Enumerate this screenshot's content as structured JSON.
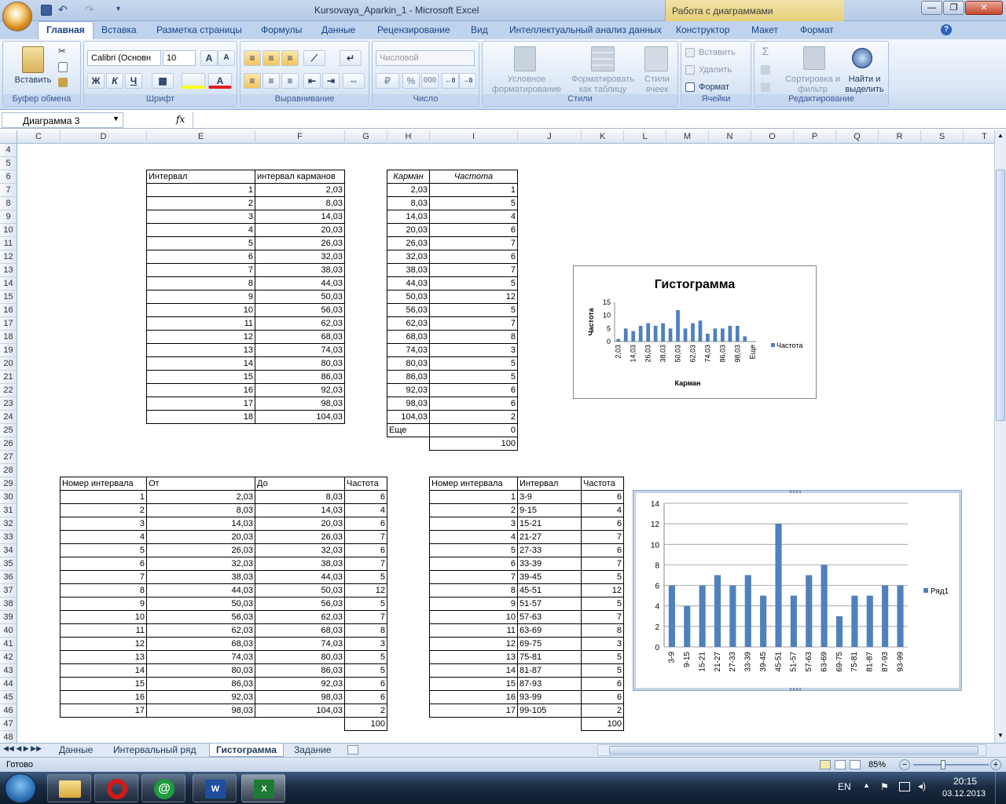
{
  "window": {
    "title": "Kursovaya_Aparkin_1 - Microsoft Excel",
    "context_title": "Работа с диаграммами",
    "minimize": "—",
    "restore": "❐",
    "close": "✕"
  },
  "tabs": [
    "Главная",
    "Вставка",
    "Разметка страницы",
    "Формулы",
    "Данные",
    "Рецензирование",
    "Вид",
    "Интеллектуальный анализ данных",
    "Конструктор",
    "Макет",
    "Формат"
  ],
  "ribbon": {
    "clipboard": {
      "label": "Буфер обмена",
      "paste": "Вставить"
    },
    "font": {
      "label": "Шрифт",
      "family": "Calibri (Основн",
      "size": "10",
      "bold": "Ж",
      "italic": "К",
      "underline": "Ч",
      "grow": "A",
      "shrink": "A"
    },
    "alignment": {
      "label": "Выравнивание"
    },
    "number": {
      "label": "Число",
      "format": "Числовой",
      "percent": "%",
      "thousands": "000"
    },
    "styles": {
      "label": "Стили",
      "conditional": "Условное форматирование",
      "as_table": "Форматировать как таблицу",
      "cell_styles": "Стили ячеек"
    },
    "cells": {
      "label": "Ячейки",
      "insert": "Вставить",
      "delete": "Удалить",
      "format": "Формат"
    },
    "editing": {
      "label": "Редактирование",
      "sum": "Σ",
      "sort": "Сортировка и фильтр",
      "find": "Найти и выделить"
    }
  },
  "formula_bar": {
    "name_box": "Диаграмма 3",
    "fx": "fx",
    "formula": ""
  },
  "columns": [
    "C",
    "D",
    "E",
    "F",
    "G",
    "H",
    "I",
    "J",
    "K",
    "L",
    "M",
    "N",
    "O",
    "P",
    "Q",
    "R",
    "S",
    "T"
  ],
  "rows": [
    "4",
    "5",
    "6",
    "7",
    "8",
    "9",
    "10",
    "11",
    "12",
    "13",
    "14",
    "15",
    "16",
    "17",
    "18",
    "19",
    "20",
    "21",
    "22",
    "23",
    "24",
    "25",
    "26",
    "27",
    "28",
    "29",
    "30",
    "31",
    "32",
    "33",
    "34",
    "35",
    "36",
    "37",
    "38",
    "39",
    "40",
    "41",
    "42",
    "43",
    "44",
    "45",
    "46",
    "47",
    "48"
  ],
  "table1": {
    "headers": [
      "Интервал",
      "интервал карманов"
    ],
    "rows": [
      [
        "1",
        "2,03"
      ],
      [
        "2",
        "8,03"
      ],
      [
        "3",
        "14,03"
      ],
      [
        "4",
        "20,03"
      ],
      [
        "5",
        "26,03"
      ],
      [
        "6",
        "32,03"
      ],
      [
        "7",
        "38,03"
      ],
      [
        "8",
        "44,03"
      ],
      [
        "9",
        "50,03"
      ],
      [
        "10",
        "56,03"
      ],
      [
        "11",
        "62,03"
      ],
      [
        "12",
        "68,03"
      ],
      [
        "13",
        "74,03"
      ],
      [
        "14",
        "80,03"
      ],
      [
        "15",
        "86,03"
      ],
      [
        "16",
        "92,03"
      ],
      [
        "17",
        "98,03"
      ],
      [
        "18",
        "104,03"
      ]
    ]
  },
  "table2": {
    "headers": [
      "Карман",
      "Частота"
    ],
    "rows": [
      [
        "2,03",
        "1"
      ],
      [
        "8,03",
        "5"
      ],
      [
        "14,03",
        "4"
      ],
      [
        "20,03",
        "6"
      ],
      [
        "26,03",
        "7"
      ],
      [
        "32,03",
        "6"
      ],
      [
        "38,03",
        "7"
      ],
      [
        "44,03",
        "5"
      ],
      [
        "50,03",
        "12"
      ],
      [
        "56,03",
        "5"
      ],
      [
        "62,03",
        "7"
      ],
      [
        "68,03",
        "8"
      ],
      [
        "74,03",
        "3"
      ],
      [
        "80,03",
        "5"
      ],
      [
        "86,03",
        "5"
      ],
      [
        "92,03",
        "6"
      ],
      [
        "98,03",
        "6"
      ],
      [
        "104,03",
        "2"
      ],
      [
        "Еще",
        "0"
      ]
    ],
    "total": "100"
  },
  "table3": {
    "headers": [
      "Номер интервала",
      "От",
      "До",
      "Частота"
    ],
    "rows": [
      [
        "1",
        "2,03",
        "8,03",
        "6"
      ],
      [
        "2",
        "8,03",
        "14,03",
        "4"
      ],
      [
        "3",
        "14,03",
        "20,03",
        "6"
      ],
      [
        "4",
        "20,03",
        "26,03",
        "7"
      ],
      [
        "5",
        "26,03",
        "32,03",
        "6"
      ],
      [
        "6",
        "32,03",
        "38,03",
        "7"
      ],
      [
        "7",
        "38,03",
        "44,03",
        "5"
      ],
      [
        "8",
        "44,03",
        "50,03",
        "12"
      ],
      [
        "9",
        "50,03",
        "56,03",
        "5"
      ],
      [
        "10",
        "56,03",
        "62,03",
        "7"
      ],
      [
        "11",
        "62,03",
        "68,03",
        "8"
      ],
      [
        "12",
        "68,03",
        "74,03",
        "3"
      ],
      [
        "13",
        "74,03",
        "80,03",
        "5"
      ],
      [
        "14",
        "80,03",
        "86,03",
        "5"
      ],
      [
        "15",
        "86,03",
        "92,03",
        "6"
      ],
      [
        "16",
        "92,03",
        "98,03",
        "6"
      ],
      [
        "17",
        "98,03",
        "104,03",
        "2"
      ]
    ],
    "total": "100"
  },
  "table4": {
    "headers": [
      "Номер интервала",
      "Интервал",
      "Частота"
    ],
    "rows": [
      [
        "1",
        "3-9",
        "6"
      ],
      [
        "2",
        "9-15",
        "4"
      ],
      [
        "3",
        "15-21",
        "6"
      ],
      [
        "4",
        "21-27",
        "7"
      ],
      [
        "5",
        "27-33",
        "6"
      ],
      [
        "6",
        "33-39",
        "7"
      ],
      [
        "7",
        "39-45",
        "5"
      ],
      [
        "8",
        "45-51",
        "12"
      ],
      [
        "9",
        "51-57",
        "5"
      ],
      [
        "10",
        "57-63",
        "7"
      ],
      [
        "11",
        "63-69",
        "8"
      ],
      [
        "12",
        "69-75",
        "3"
      ],
      [
        "13",
        "75-81",
        "5"
      ],
      [
        "14",
        "81-87",
        "5"
      ],
      [
        "15",
        "87-93",
        "6"
      ],
      [
        "16",
        "93-99",
        "6"
      ],
      [
        "17",
        "99-105",
        "2"
      ]
    ],
    "total": "100"
  },
  "chart_data": [
    {
      "type": "bar",
      "title": "Гистограмма",
      "xlabel": "Карман",
      "ylabel": "Частота",
      "categories": [
        "2,03",
        "8,03",
        "14,03",
        "20,03",
        "26,03",
        "32,03",
        "38,03",
        "44,03",
        "50,03",
        "56,03",
        "62,03",
        "68,03",
        "74,03",
        "80,03",
        "86,03",
        "92,03",
        "98,03",
        "104,03",
        "Еще"
      ],
      "tick_labels": [
        "2,03",
        "14,03",
        "26,03",
        "38,03",
        "50,03",
        "62,03",
        "74,03",
        "86,03",
        "98,03",
        "Еще"
      ],
      "series": [
        {
          "name": "Частота",
          "values": [
            1,
            5,
            4,
            6,
            7,
            6,
            7,
            5,
            12,
            5,
            7,
            8,
            3,
            5,
            5,
            6,
            6,
            2,
            0
          ]
        }
      ],
      "yticks": [
        "0",
        "5",
        "10",
        "15"
      ],
      "ylim": [
        0,
        15
      ],
      "legend": "right",
      "color": "#4f81bd"
    },
    {
      "type": "bar",
      "title": "",
      "categories": [
        "3-9",
        "9-15",
        "15-21",
        "21-27",
        "27-33",
        "33-39",
        "39-45",
        "45-51",
        "51-57",
        "57-63",
        "63-69",
        "69-75",
        "75-81",
        "81-87",
        "87-93",
        "93-99"
      ],
      "series": [
        {
          "name": "Ряд1",
          "values": [
            6,
            4,
            6,
            7,
            6,
            7,
            5,
            12,
            5,
            7,
            8,
            3,
            5,
            5,
            6,
            6
          ]
        }
      ],
      "yticks": [
        "0",
        "2",
        "4",
        "6",
        "8",
        "10",
        "12",
        "14"
      ],
      "ylim": [
        0,
        14
      ],
      "grid": true,
      "legend": "right",
      "color": "#4f81bd"
    }
  ],
  "sheets": [
    "Данные",
    "Интервальный ряд",
    "Гистограмма",
    "Задание"
  ],
  "status": {
    "ready": "Готово",
    "zoom": "85%"
  },
  "taskbar": {
    "lang": "EN",
    "time": "20:15",
    "date": "03.12.2013"
  }
}
